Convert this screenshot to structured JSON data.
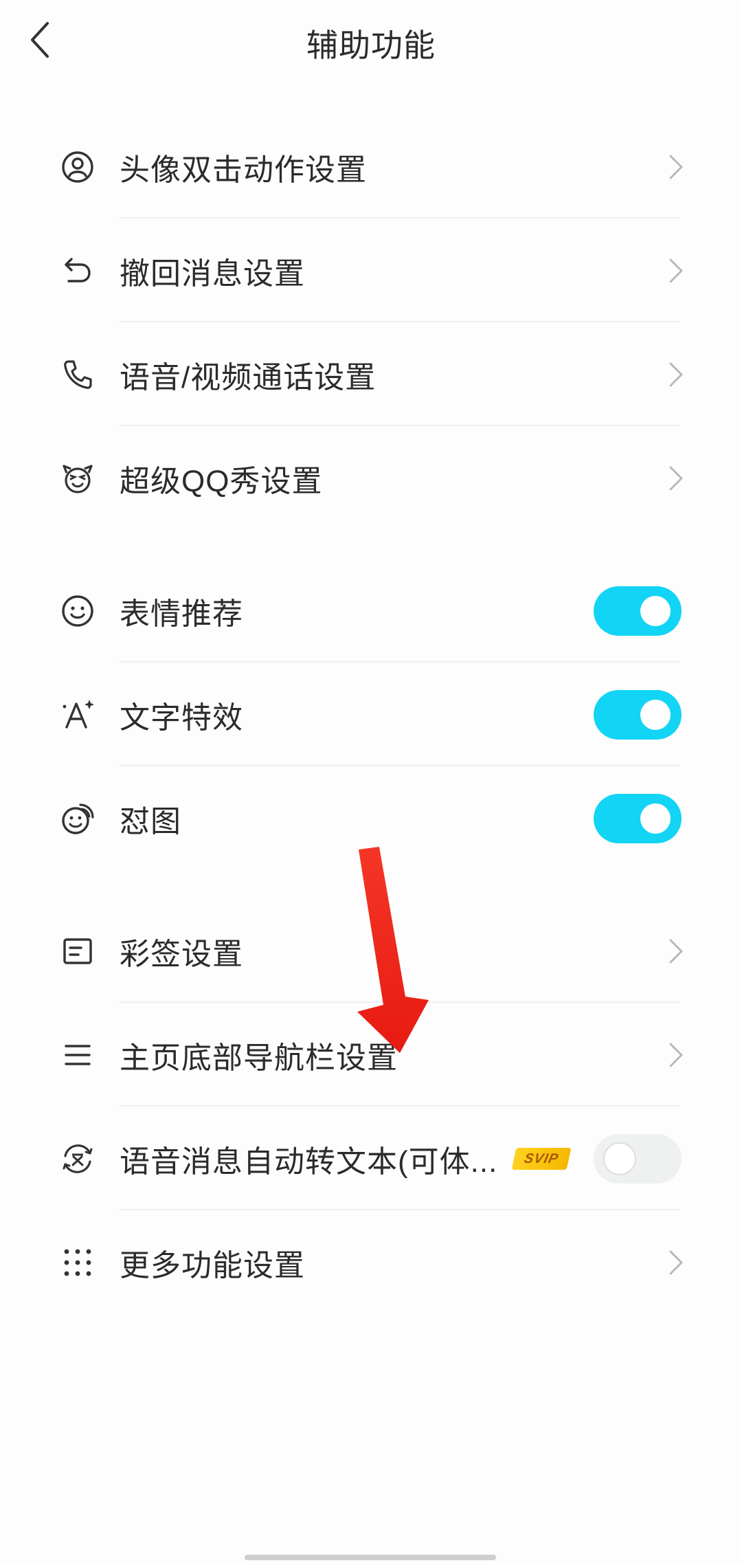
{
  "header": {
    "title": "辅助功能",
    "back_icon": "chevron-left-icon"
  },
  "group1": [
    {
      "label": "头像双击动作设置",
      "icon": "avatar-icon"
    },
    {
      "label": "撤回消息设置",
      "icon": "undo-icon"
    },
    {
      "label": "语音/视频通话设置",
      "icon": "phone-icon"
    },
    {
      "label": "超级QQ秀设置",
      "icon": "qq-show-icon"
    }
  ],
  "group2": [
    {
      "label": "表情推荐",
      "icon": "smiley-icon",
      "enabled": true
    },
    {
      "label": "文字特效",
      "icon": "text-effect-icon",
      "enabled": true
    },
    {
      "label": "怼图",
      "icon": "sticker-icon",
      "enabled": true
    }
  ],
  "group3": [
    {
      "label": "彩签设置",
      "icon": "tag-icon"
    },
    {
      "label": "主页底部导航栏设置",
      "icon": "menu-icon"
    },
    {
      "label": "语音消息自动转文本(可体...",
      "icon": "voice-to-text-icon",
      "badge": "SVIP",
      "enabled": false
    },
    {
      "label": "更多功能设置",
      "icon": "grid-icon"
    }
  ],
  "colors": {
    "toggle_on": "#12d4f5",
    "toggle_off": "#eef1f0",
    "svip_badge": "#ffd21f",
    "annotation_arrow": "#f0241a"
  }
}
